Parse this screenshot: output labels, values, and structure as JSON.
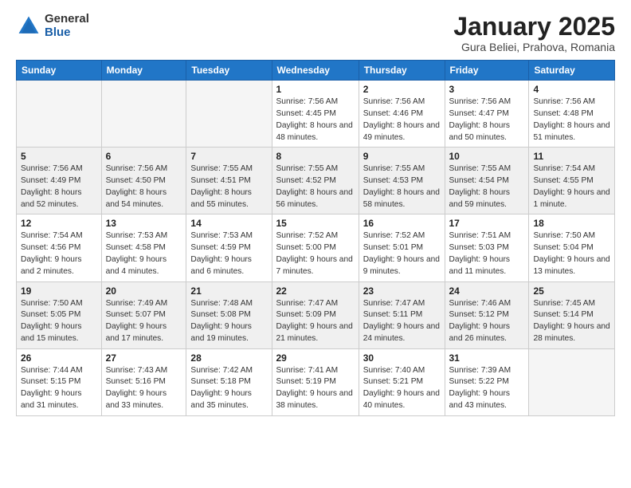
{
  "logo": {
    "general": "General",
    "blue": "Blue"
  },
  "title": {
    "month": "January 2025",
    "location": "Gura Beliei, Prahova, Romania"
  },
  "weekdays": [
    "Sunday",
    "Monday",
    "Tuesday",
    "Wednesday",
    "Thursday",
    "Friday",
    "Saturday"
  ],
  "weeks": [
    [
      {
        "day": "",
        "empty": true
      },
      {
        "day": "",
        "empty": true
      },
      {
        "day": "",
        "empty": true
      },
      {
        "day": "1",
        "sunrise": "7:56 AM",
        "sunset": "4:45 PM",
        "daylight": "8 hours and 48 minutes."
      },
      {
        "day": "2",
        "sunrise": "7:56 AM",
        "sunset": "4:46 PM",
        "daylight": "8 hours and 49 minutes."
      },
      {
        "day": "3",
        "sunrise": "7:56 AM",
        "sunset": "4:47 PM",
        "daylight": "8 hours and 50 minutes."
      },
      {
        "day": "4",
        "sunrise": "7:56 AM",
        "sunset": "4:48 PM",
        "daylight": "8 hours and 51 minutes."
      }
    ],
    [
      {
        "day": "5",
        "sunrise": "7:56 AM",
        "sunset": "4:49 PM",
        "daylight": "8 hours and 52 minutes."
      },
      {
        "day": "6",
        "sunrise": "7:56 AM",
        "sunset": "4:50 PM",
        "daylight": "8 hours and 54 minutes."
      },
      {
        "day": "7",
        "sunrise": "7:55 AM",
        "sunset": "4:51 PM",
        "daylight": "8 hours and 55 minutes."
      },
      {
        "day": "8",
        "sunrise": "7:55 AM",
        "sunset": "4:52 PM",
        "daylight": "8 hours and 56 minutes."
      },
      {
        "day": "9",
        "sunrise": "7:55 AM",
        "sunset": "4:53 PM",
        "daylight": "8 hours and 58 minutes."
      },
      {
        "day": "10",
        "sunrise": "7:55 AM",
        "sunset": "4:54 PM",
        "daylight": "8 hours and 59 minutes."
      },
      {
        "day": "11",
        "sunrise": "7:54 AM",
        "sunset": "4:55 PM",
        "daylight": "9 hours and 1 minute."
      }
    ],
    [
      {
        "day": "12",
        "sunrise": "7:54 AM",
        "sunset": "4:56 PM",
        "daylight": "9 hours and 2 minutes."
      },
      {
        "day": "13",
        "sunrise": "7:53 AM",
        "sunset": "4:58 PM",
        "daylight": "9 hours and 4 minutes."
      },
      {
        "day": "14",
        "sunrise": "7:53 AM",
        "sunset": "4:59 PM",
        "daylight": "9 hours and 6 minutes."
      },
      {
        "day": "15",
        "sunrise": "7:52 AM",
        "sunset": "5:00 PM",
        "daylight": "9 hours and 7 minutes."
      },
      {
        "day": "16",
        "sunrise": "7:52 AM",
        "sunset": "5:01 PM",
        "daylight": "9 hours and 9 minutes."
      },
      {
        "day": "17",
        "sunrise": "7:51 AM",
        "sunset": "5:03 PM",
        "daylight": "9 hours and 11 minutes."
      },
      {
        "day": "18",
        "sunrise": "7:50 AM",
        "sunset": "5:04 PM",
        "daylight": "9 hours and 13 minutes."
      }
    ],
    [
      {
        "day": "19",
        "sunrise": "7:50 AM",
        "sunset": "5:05 PM",
        "daylight": "9 hours and 15 minutes."
      },
      {
        "day": "20",
        "sunrise": "7:49 AM",
        "sunset": "5:07 PM",
        "daylight": "9 hours and 17 minutes."
      },
      {
        "day": "21",
        "sunrise": "7:48 AM",
        "sunset": "5:08 PM",
        "daylight": "9 hours and 19 minutes."
      },
      {
        "day": "22",
        "sunrise": "7:47 AM",
        "sunset": "5:09 PM",
        "daylight": "9 hours and 21 minutes."
      },
      {
        "day": "23",
        "sunrise": "7:47 AM",
        "sunset": "5:11 PM",
        "daylight": "9 hours and 24 minutes."
      },
      {
        "day": "24",
        "sunrise": "7:46 AM",
        "sunset": "5:12 PM",
        "daylight": "9 hours and 26 minutes."
      },
      {
        "day": "25",
        "sunrise": "7:45 AM",
        "sunset": "5:14 PM",
        "daylight": "9 hours and 28 minutes."
      }
    ],
    [
      {
        "day": "26",
        "sunrise": "7:44 AM",
        "sunset": "5:15 PM",
        "daylight": "9 hours and 31 minutes."
      },
      {
        "day": "27",
        "sunrise": "7:43 AM",
        "sunset": "5:16 PM",
        "daylight": "9 hours and 33 minutes."
      },
      {
        "day": "28",
        "sunrise": "7:42 AM",
        "sunset": "5:18 PM",
        "daylight": "9 hours and 35 minutes."
      },
      {
        "day": "29",
        "sunrise": "7:41 AM",
        "sunset": "5:19 PM",
        "daylight": "9 hours and 38 minutes."
      },
      {
        "day": "30",
        "sunrise": "7:40 AM",
        "sunset": "5:21 PM",
        "daylight": "9 hours and 40 minutes."
      },
      {
        "day": "31",
        "sunrise": "7:39 AM",
        "sunset": "5:22 PM",
        "daylight": "9 hours and 43 minutes."
      },
      {
        "day": "",
        "empty": true
      }
    ]
  ]
}
